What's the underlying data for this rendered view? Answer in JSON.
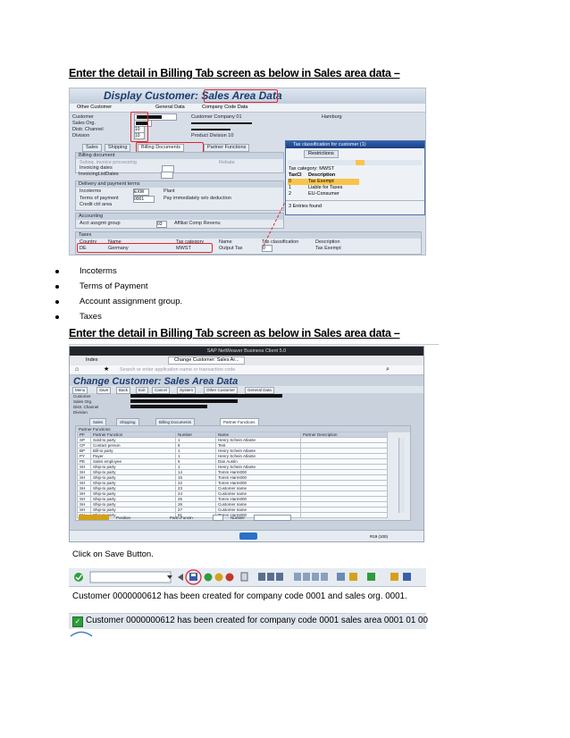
{
  "headings": {
    "h1": "Enter the detail in  Billing  Tab screen as below in Sales area data –",
    "h2": "Enter the detail in  Billing  Tab screen as below in Sales area data –"
  },
  "screenshot1": {
    "title": "Display Customer: Sales Area Data",
    "toolbar": [
      "Other Customer",
      "General Data",
      "Company Code Data"
    ],
    "fields": {
      "customer_label": "Customer",
      "customer_value": "Customer Company 01",
      "customer_city": "Hamburg",
      "sales_org_label": "Sales Org.",
      "dist_channel_label": "Distr. Channel",
      "dist_channel_value": "10",
      "division_label": "Division",
      "division_value": "10",
      "division_text": "Product Division 10"
    },
    "tabs": [
      "Sales",
      "Shipping",
      "Billing Documents",
      "Partner Functions"
    ],
    "billing": {
      "section": "Billing document",
      "subseq": "Subsq. invoice processing",
      "rebate": "Rebate",
      "invoicing_dates": "Invoicing dates",
      "invoicing_list_dates": "InvoicingListDates"
    },
    "delivery": {
      "section": "Delivery and payment terms",
      "incoterms_label": "Incoterms",
      "incoterms_value": "EXW",
      "plant_label": "Plant",
      "terms_label": "Terms of payment",
      "terms_value": "0001",
      "terms_text": "Pay immediately w/o deduction",
      "credit_label": "Credit ctrl area"
    },
    "accounting": {
      "section": "Accounting",
      "acct_label": "Acct assgmt group",
      "acct_value": "03",
      "acct_text": "Affiliat Comp Revenu"
    },
    "taxes": {
      "section": "Taxes",
      "headers": [
        "Country",
        "Name",
        "Tax category",
        "Name",
        "Tax classification",
        "Description"
      ],
      "row": [
        "DE",
        "Germany",
        "MWST",
        "Output Tax",
        "0",
        "Tax Exempt"
      ]
    },
    "popup": {
      "title": "Tax classification for customer (1)",
      "restrictions_tab": "Restrictions",
      "tax_category": "Tax category: MWST",
      "col_taxcl": "TaxCl",
      "col_desc": "Description",
      "rows": [
        {
          "code": "0",
          "desc": "Tax Exempt"
        },
        {
          "code": "1",
          "desc": "Liable for Taxes"
        },
        {
          "code": "2",
          "desc": "EU-Consumer"
        }
      ],
      "footer": "3 Entries found"
    }
  },
  "bullets": [
    "Incoterms",
    "Terms of Payment",
    "Account assignment group.",
    "Taxes"
  ],
  "screenshot2": {
    "window_title": "SAP NetWeaver Business Client 5.0",
    "browser_tabs": [
      "Index",
      "Change Customer: Sales Ar..."
    ],
    "search_placeholder": "Search or enter application name or transaction code",
    "title": "Change Customer: Sales Area Data",
    "menu_buttons": [
      "Menu",
      "Save",
      "Back",
      "Exit",
      "Cancel",
      "System",
      "Other Customer",
      "General Data"
    ],
    "fields": [
      "Customer",
      "Sales Org.",
      "Distr. Channel",
      "Division"
    ],
    "tabs": [
      "Sales",
      "Shipping",
      "Billing Documents",
      "Partner Functions"
    ],
    "section": "Partner Functions",
    "headers": [
      "PF",
      "Partner Function",
      "Number",
      "Name",
      "Partner Description"
    ],
    "rows": [
      [
        "SP",
        "Sold-to party",
        "1",
        "Henry Schein Atlante",
        ""
      ],
      [
        "CP",
        "Contact person",
        "8",
        "Test",
        ""
      ],
      [
        "BP",
        "Bill-to party",
        "1",
        "Henry Schein Atlante",
        ""
      ],
      [
        "PY",
        "Payer",
        "1",
        "Henry Schein Atlante",
        ""
      ],
      [
        "PE",
        "Sales employee",
        "5",
        "Dan Austin",
        ""
      ],
      [
        "SH",
        "Ship-to party",
        "1",
        "Henry Schein Atlante",
        ""
      ],
      [
        "SH",
        "Ship-to party",
        "14",
        "Tomm Harm000",
        ""
      ],
      [
        "SH",
        "Ship-to party",
        "15",
        "Tomm Harm000",
        ""
      ],
      [
        "SH",
        "Ship-to party",
        "22",
        "Tomm Harm000",
        ""
      ],
      [
        "SH",
        "Ship-to party",
        "23",
        "Customer name",
        ""
      ],
      [
        "SH",
        "Ship-to party",
        "24",
        "Customer name",
        ""
      ],
      [
        "SH",
        "Ship-to party",
        "25",
        "Tomm Harm000",
        ""
      ],
      [
        "SH",
        "Ship-to party",
        "26",
        "Customer name",
        ""
      ],
      [
        "SH",
        "Ship-to party",
        "27",
        "Customer name",
        ""
      ],
      [
        "SH",
        "Ship-to party",
        "61",
        "Tomm Harm000",
        ""
      ]
    ],
    "position_label": "Position",
    "partn_func_label": "Partn.Functn",
    "number_label": "Number",
    "status_right": "R19 (100)"
  },
  "click_text": "Click on Save Button.",
  "message_plain": "Customer 0000000612  has been created for company code 0001 and sales org. 0001.",
  "message_status": "Customer 0000000612 has been created for company code 0001 sales area 0001 01 00",
  "colors": {
    "sap_blue": "#1c3c70",
    "highlight_red": "#e0262e",
    "status_green": "#2e9d3a"
  }
}
